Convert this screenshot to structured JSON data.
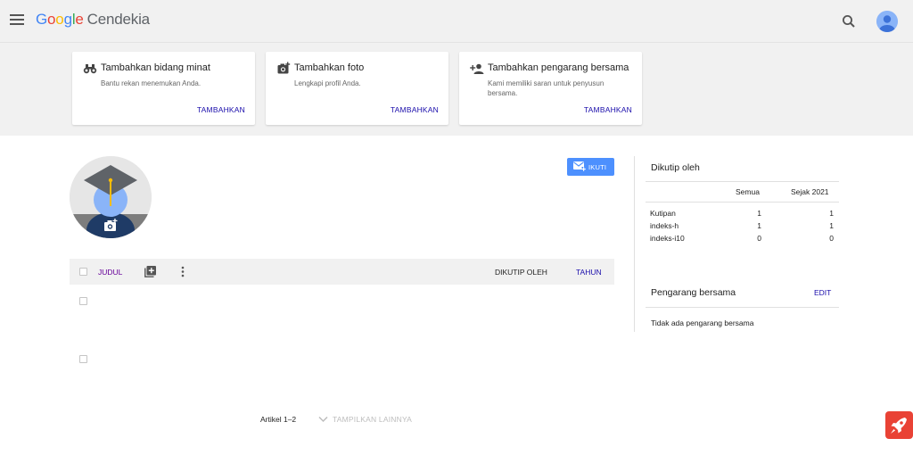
{
  "header": {
    "brand_letters": [
      "G",
      "o",
      "o",
      "g",
      "l",
      "e"
    ],
    "brand_suffix": "Cendekia",
    "menu_icon": "menu-icon",
    "search_icon": "search-icon",
    "account_icon": "account-avatar-icon"
  },
  "banner": {
    "cards": [
      {
        "icon": "binoculars-icon",
        "title": "Tambahkan bidang minat",
        "desc": "Bantu rekan menemukan Anda.",
        "action": "TAMBAHKAN"
      },
      {
        "icon": "add-photo-icon",
        "title": "Tambahkan foto",
        "desc": "Lengkapi profil Anda.",
        "action": "TAMBAHKAN"
      },
      {
        "icon": "add-person-icon",
        "title": "Tambahkan pengarang bersama",
        "desc": "Kami memiliki saran untuk penyusun bersama.",
        "action": "TAMBAHKAN"
      }
    ]
  },
  "profile": {
    "follow_label": "IKUTI"
  },
  "articles": {
    "col_title": "JUDUL",
    "col_cited": "DIKUTIP OLEH",
    "col_year": "TAHUN",
    "count_text": "Artikel 1–2",
    "show_more": "TAMPILKAN LAINNYA"
  },
  "cited_by": {
    "title": "Dikutip oleh",
    "col_all": "Semua",
    "col_since": "Sejak 2021",
    "rows": [
      {
        "label": "Kutipan",
        "all": "1",
        "since": "1"
      },
      {
        "label": "indeks-h",
        "all": "1",
        "since": "1"
      },
      {
        "label": "indeks-i10",
        "all": "0",
        "since": "0"
      }
    ]
  },
  "coauthors": {
    "title": "Pengarang bersama",
    "edit": "EDIT",
    "empty": "Tidak ada pengarang bersama"
  },
  "colors": {
    "link": "#1a0dab",
    "accent_button": "#4d90fe",
    "rocket": "#e94235"
  }
}
